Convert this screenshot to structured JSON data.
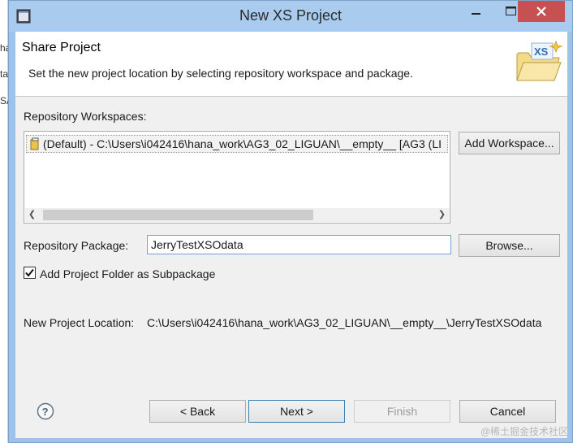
{
  "background_window": {
    "fragments": [
      "ha",
      "ta",
      "SA"
    ]
  },
  "window": {
    "title": "New XS Project",
    "icons": {
      "app": "eclipse-window-icon",
      "minimize": "minimize-icon",
      "maximize": "maximize-icon",
      "close": "close-icon"
    }
  },
  "banner": {
    "title": "Share Project",
    "description": "Set the new project location by selecting repository workspace and package.",
    "icon": "xs-folder-icon",
    "icon_text": "XS"
  },
  "workspaces": {
    "label": "Repository Workspaces:",
    "items": [
      "(Default) - C:\\Users\\i042416\\hana_work\\AG3_02_LIGUAN\\__empty__ [AG3 (LI"
    ],
    "add_button": "Add Workspace..."
  },
  "package": {
    "label": "Repository Package:",
    "value": "JerryTestXSOdata",
    "browse_button": "Browse..."
  },
  "subpackage": {
    "label": "Add Project Folder as Subpackage",
    "checked": true
  },
  "location": {
    "label": "New Project Location:",
    "value": "C:\\Users\\i042416\\hana_work\\AG3_02_LIGUAN\\__empty__\\JerryTestXSOdata"
  },
  "buttons": {
    "back": "< Back",
    "next": "Next >",
    "finish": "Finish",
    "cancel": "Cancel"
  },
  "watermark": "@稀土掘金技术社区",
  "colors": {
    "titlebar": "#a9cbee",
    "close": "#c75050",
    "default_button_border": "#3c7fb1"
  }
}
